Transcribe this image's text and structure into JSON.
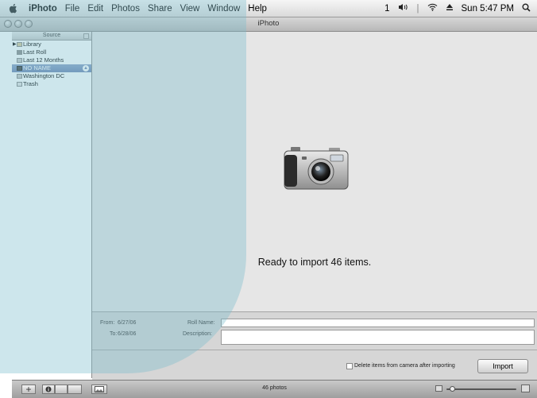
{
  "menubar": {
    "app_name": "iPhoto",
    "items": [
      "File",
      "Edit",
      "Photos",
      "Share",
      "View",
      "Window",
      "Help"
    ],
    "status": {
      "display_num": "1",
      "clock": "Sun 5:47 PM"
    }
  },
  "window": {
    "title": "iPhoto"
  },
  "source": {
    "header": "Source",
    "items": [
      {
        "label": "Library"
      },
      {
        "label": "Last Roll"
      },
      {
        "label": "Last 12 Months"
      },
      {
        "label": "NO NAME"
      },
      {
        "label": "Washington DC"
      },
      {
        "label": "Trash"
      }
    ]
  },
  "main": {
    "status_text": "Ready to import 46 items."
  },
  "import_panel": {
    "from_label": "From:",
    "from_value": "6/27/06",
    "to_label": "To:",
    "to_value": "6/28/06",
    "roll_name_label": "Roll Name:",
    "roll_name_value": "",
    "description_label": "Description:",
    "description_value": "",
    "delete_label": "Delete items from camera after importing",
    "import_button": "Import"
  },
  "bottombar": {
    "photo_count": "46 photos",
    "zoom_level": 0.05
  },
  "icons": [
    "apple-icon",
    "volume-icon",
    "wifi-icon",
    "eject-icon",
    "spotlight-icon",
    "camera-icon",
    "add-icon",
    "info-icon",
    "slideshow-icon",
    "fullscreen-icon"
  ],
  "colors": {
    "selection": "#6e86b3",
    "watermark": "#7cbecd"
  }
}
